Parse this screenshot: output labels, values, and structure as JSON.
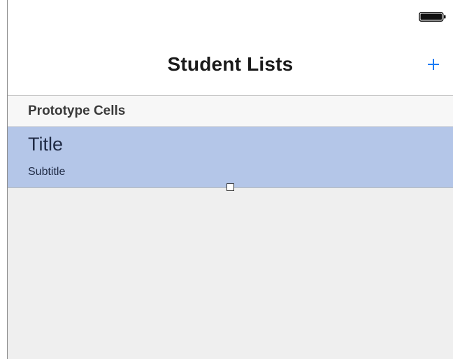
{
  "status_bar": {
    "battery_icon": "battery-full-icon"
  },
  "nav_bar": {
    "title": "Student Lists",
    "add_icon": "plus-icon",
    "accent_color": "#1a7cf5"
  },
  "table": {
    "section_header": "Prototype Cells",
    "cell": {
      "title": "Title",
      "subtitle": "Subtitle",
      "selection_color": "#b4c6e8"
    }
  }
}
